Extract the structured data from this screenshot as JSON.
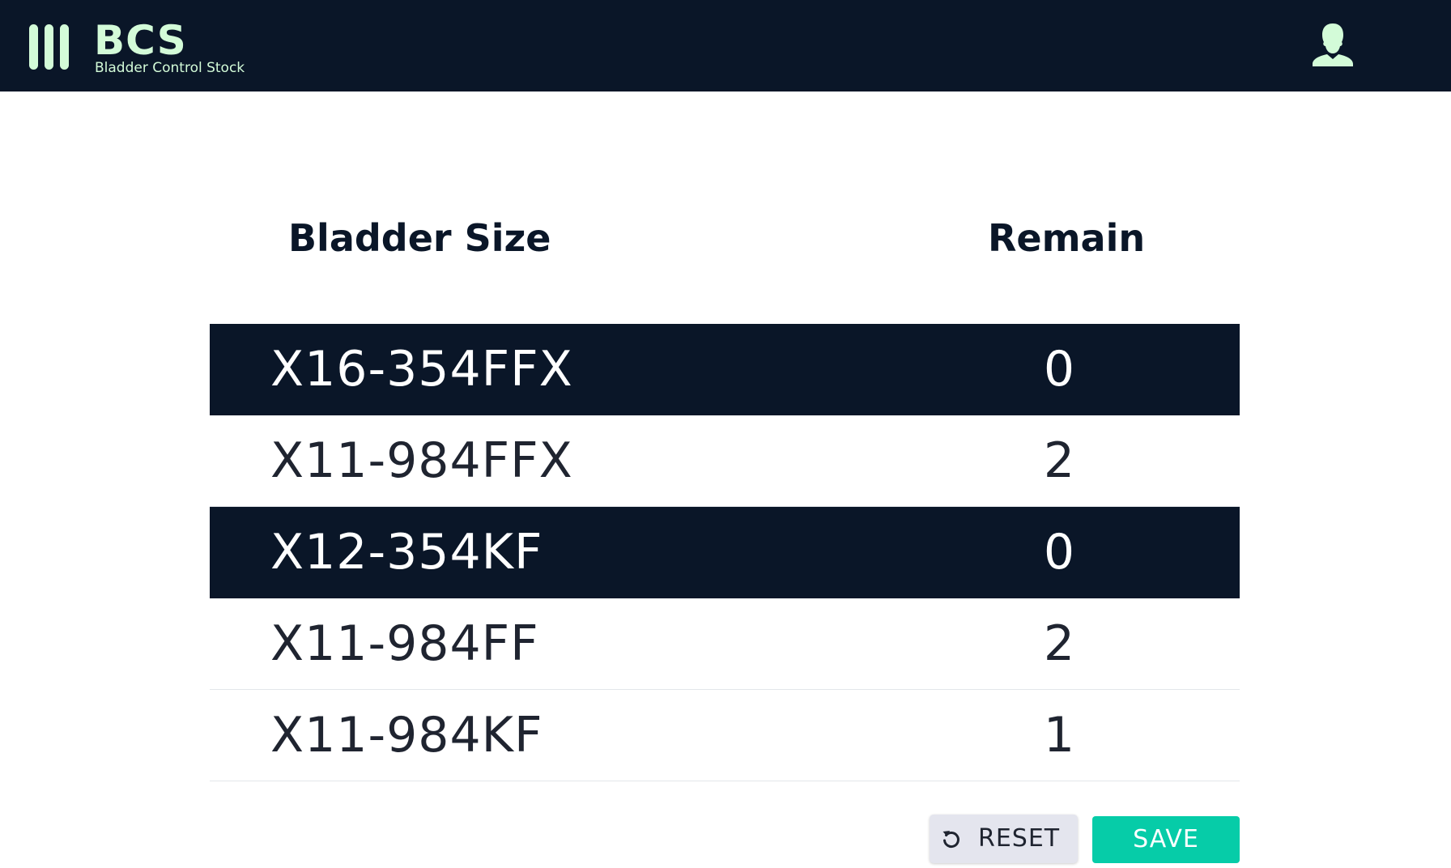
{
  "app": {
    "title": "BCS",
    "subtitle": "Bladder Control Stock"
  },
  "header": {
    "menu_icon": "menu-icon",
    "user_icon": "user-icon"
  },
  "table": {
    "columns": [
      "Bladder Size",
      "Remain"
    ],
    "rows": [
      {
        "size": "X16-354FFX",
        "remain": "0"
      },
      {
        "size": "X11-984FFX",
        "remain": "2"
      },
      {
        "size": "X12-354KF",
        "remain": "0"
      },
      {
        "size": "X11-984FF",
        "remain": "2"
      },
      {
        "size": "X11-984KF",
        "remain": "1"
      }
    ]
  },
  "actions": {
    "reset_label": "RESET",
    "reset_icon": "refresh-icon",
    "save_label": "SAVE"
  },
  "colors": {
    "header_bg": "#0a1628",
    "brand_accent": "#d3fbd8",
    "save_button": "#06cca8",
    "reset_button": "#e4e5ee",
    "highlight_row": "#0a1628"
  }
}
